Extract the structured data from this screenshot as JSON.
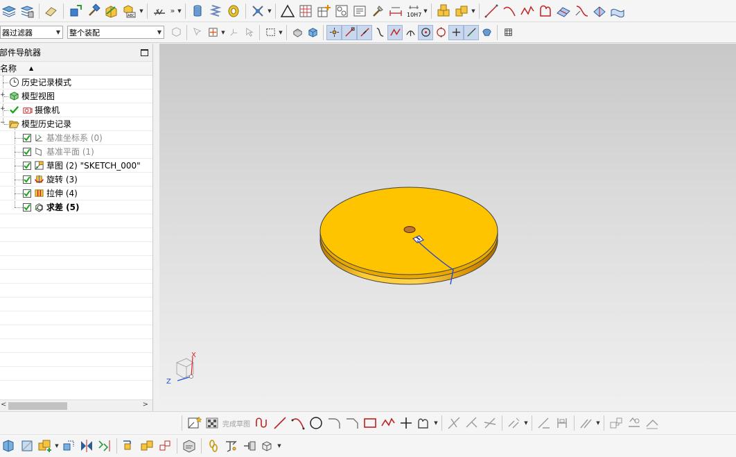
{
  "filter_toolbar": {
    "type_filter": "器过滤器",
    "scope_filter": "整个装配"
  },
  "navigator": {
    "title": "部件导航器",
    "column_name": "名称",
    "items": [
      {
        "label": "历史记录模式",
        "icon": "clock-icon"
      },
      {
        "label": "模型视图",
        "icon": "model-views-icon"
      },
      {
        "label": "摄像机",
        "icon": "camera-icon"
      },
      {
        "label": "模型历史记录",
        "icon": "folder-open-icon"
      },
      {
        "label": "基准坐标系 (0)",
        "icon": "datum-csys-icon"
      },
      {
        "label": "基准平面 (1)",
        "icon": "datum-plane-icon"
      },
      {
        "label": "草图 (2) \"SKETCH_000\"",
        "icon": "sketch-icon"
      },
      {
        "label": "旋转 (3)",
        "icon": "revolve-icon"
      },
      {
        "label": "拉伸 (4)",
        "icon": "extrude-icon"
      },
      {
        "label": "求差 (5)",
        "icon": "subtract-icon"
      }
    ]
  },
  "sketch_toolbar": {
    "finish_sketch_label": "完成草图"
  },
  "viewport": {
    "triad_x_label": "X",
    "triad_z_label": "Z"
  },
  "colors": {
    "part_face": "#ffc400",
    "part_edge": "#404040",
    "viewport_top": "#c8c8c8",
    "viewport_bottom": "#f0f0f0"
  }
}
